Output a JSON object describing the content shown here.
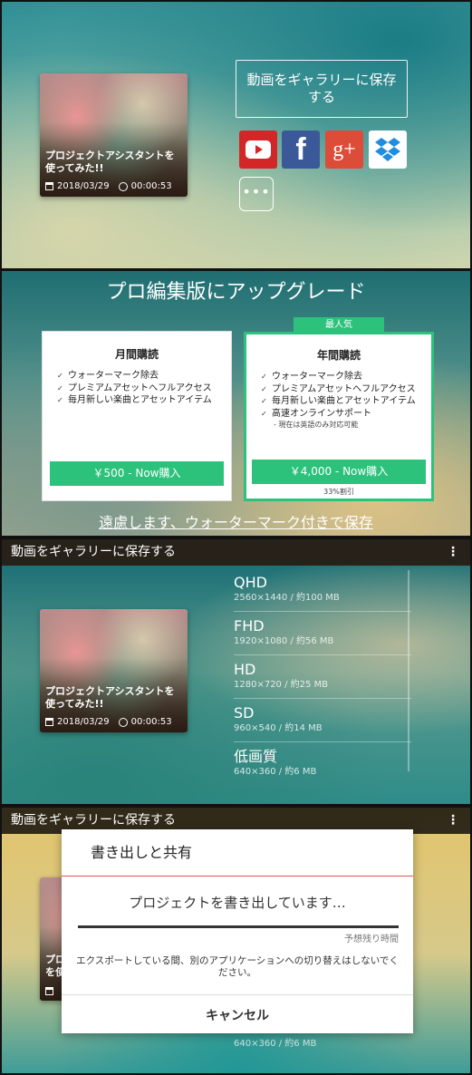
{
  "video": {
    "title": "プロジェクトアシスタントを使ってみた!!",
    "date": "2018/03/29",
    "duration": "00:00:53"
  },
  "share": {
    "save_label": "動画をギャラリーに保存する",
    "icons": [
      "youtube-icon",
      "facebook-icon",
      "google-plus-icon",
      "dropbox-icon"
    ],
    "facebook_glyph": "f",
    "google_glyph": "g+",
    "more_label": "•••"
  },
  "upgrade": {
    "title": "プロ編集版にアップグレード",
    "popular_badge": "最人気",
    "monthly": {
      "name": "月間購読",
      "features": [
        "ウォーターマーク除去",
        "プレミアムアセットへフルアクセス",
        "毎月新しい楽曲とアセットアイテム"
      ],
      "button": "￥500 - Now購入"
    },
    "yearly": {
      "name": "年間購読",
      "features": [
        "ウォーターマーク除去",
        "プレミアムアセットへフルアクセス",
        "毎月新しい楽曲とアセットアイテム",
        "高速オンラインサポート"
      ],
      "note": "- 現在は英語のみ対応可能",
      "button": "￥4,000 - Now購入",
      "discount": "33%割引"
    },
    "decline": "遠慮します、ウォーターマーク付きで保存"
  },
  "gallery": {
    "header": "動画をギャラリーに保存する",
    "menu": "⋮",
    "resolutions": [
      {
        "name": "QHD",
        "spec": "2560×1440 / 約100 MB"
      },
      {
        "name": "FHD",
        "spec": "1920×1080 / 約56 MB"
      },
      {
        "name": "HD",
        "spec": "1280×720 / 約25 MB"
      },
      {
        "name": "SD",
        "spec": "960×540 / 約14 MB"
      },
      {
        "name": "低画質",
        "spec": "640×360 / 約6 MB"
      }
    ]
  },
  "export": {
    "header": "動画をギャラリーに保存する",
    "menu": "⋮",
    "title": "書き出しと共有",
    "message": "プロジェクトを書き出しています…",
    "progress": 1.0,
    "remaining": "予想残り時間",
    "warning": "エクスポートしている間、別のアプリケーションへの切り替えはしないでください。",
    "cancel": "キャンセル",
    "behind_thumb_lines": [
      "プロ",
      "を使"
    ],
    "behind_spec": "640×360 / 約6 MB"
  }
}
